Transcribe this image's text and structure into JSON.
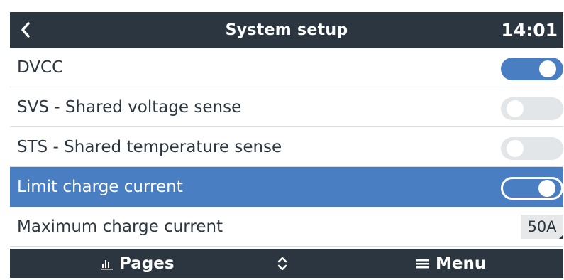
{
  "header": {
    "title": "System setup",
    "time": "14:01",
    "back_icon": "chevron-left-icon"
  },
  "rows": [
    {
      "label": "DVCC",
      "control": "toggle",
      "state": "on"
    },
    {
      "label": "SVS - Shared voltage sense",
      "control": "toggle",
      "state": "off"
    },
    {
      "label": "STS - Shared temperature sense",
      "control": "toggle",
      "state": "off"
    },
    {
      "label": "Limit charge current",
      "control": "toggle",
      "state": "on",
      "selected": true
    },
    {
      "label": "Maximum charge current",
      "control": "value",
      "value": "50A"
    }
  ],
  "footer": {
    "pages_label": "Pages",
    "pages_icon": "bar-chart-icon",
    "updown_icon": "up-down-chevron-icon",
    "menu_label": "Menu",
    "menu_icon": "hamburger-menu-icon"
  },
  "colors": {
    "header_bg": "#2b3640",
    "accent": "#4a7ec2",
    "toggle_off": "#e3e6e8",
    "text": "#2b3640"
  }
}
